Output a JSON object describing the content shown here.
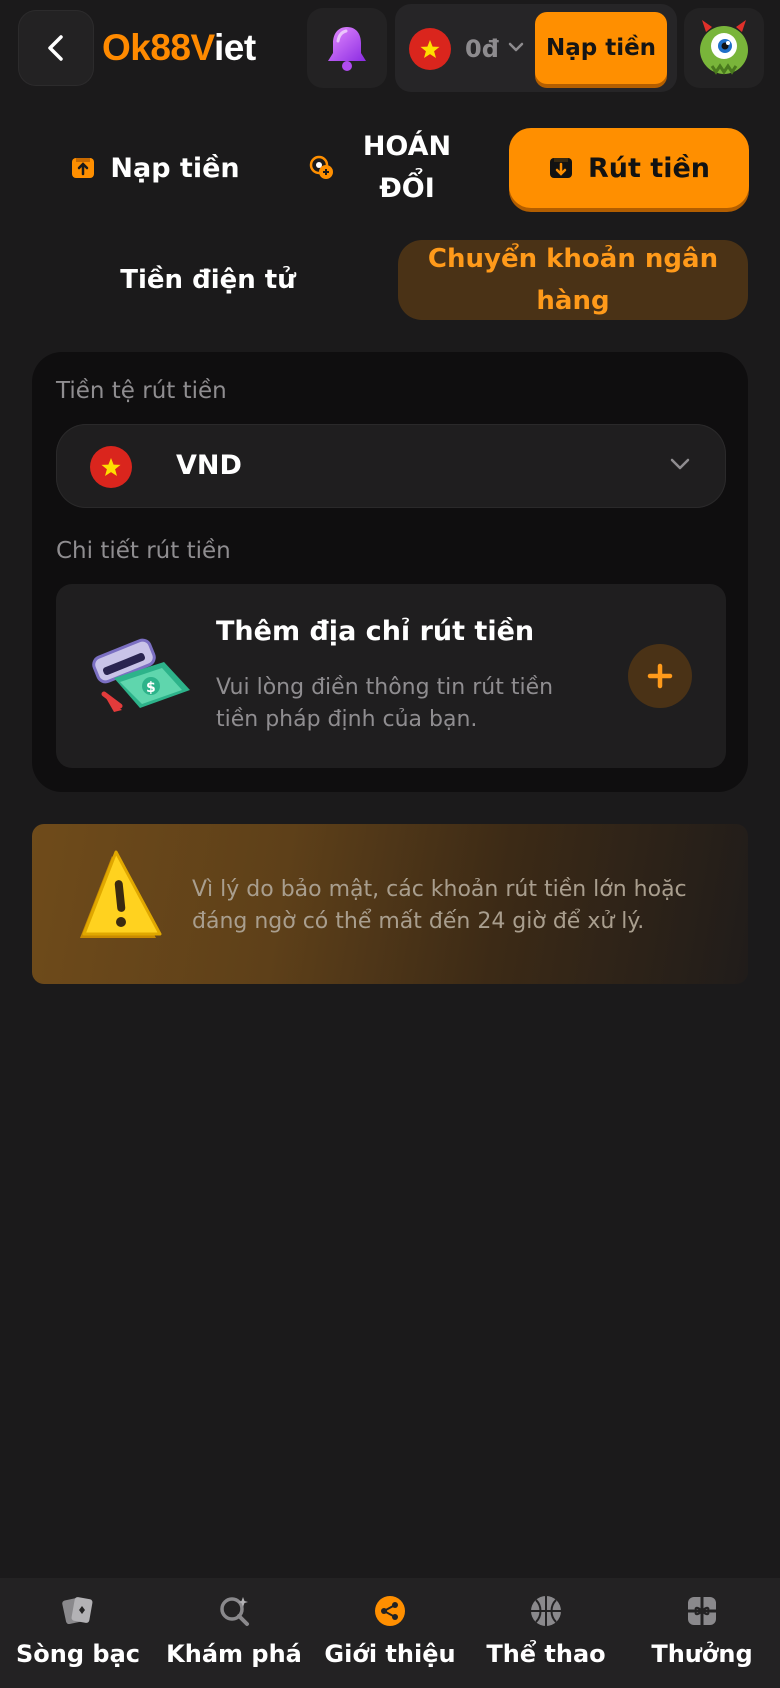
{
  "header": {
    "logo_text_a": "Ok88",
    "logo_text_b": "V",
    "logo_text_c": "iet",
    "balance": "0đ",
    "deposit_button": "Nạp tiền"
  },
  "main_tabs": [
    {
      "label": "Nạp tiền",
      "icon": "deposit-icon",
      "active": false
    },
    {
      "label": "HOÁN ĐỔI",
      "icon": "exchange-icon",
      "active": false
    },
    {
      "label": "Rút tiền",
      "icon": "withdraw-icon",
      "active": true
    }
  ],
  "sub_tabs": [
    {
      "label": "Tiền điện tử",
      "active": false
    },
    {
      "label": "Chuyển khoản ngân hàng",
      "active": true
    }
  ],
  "form": {
    "currency_label": "Tiền tệ rút tiền",
    "currency_value": "VND",
    "details_label": "Chi tiết rút tiền",
    "address_title": "Thêm địa chỉ rút tiền",
    "address_desc": "Vui lòng điền thông tin rút tiền tiền pháp định của bạn."
  },
  "warning": {
    "text": "Vì lý do bảo mật, các khoản rút tiền lớn hoặc đáng ngờ có thể mất đến 24 giờ để xử lý."
  },
  "bottom_nav": [
    {
      "label": "Sòng bạc",
      "icon": "casino-cards-icon"
    },
    {
      "label": "Khám phá",
      "icon": "explore-search-icon"
    },
    {
      "label": "Giới thiệu",
      "icon": "share-referral-icon"
    },
    {
      "label": "Thể thao",
      "icon": "basketball-icon"
    },
    {
      "label": "Thưởng",
      "icon": "gift-icon"
    }
  ],
  "colors": {
    "accent": "#ff8f00",
    "background": "#1b1a1b",
    "card": "#0f0e0f",
    "muted_text": "#8f8d90"
  }
}
